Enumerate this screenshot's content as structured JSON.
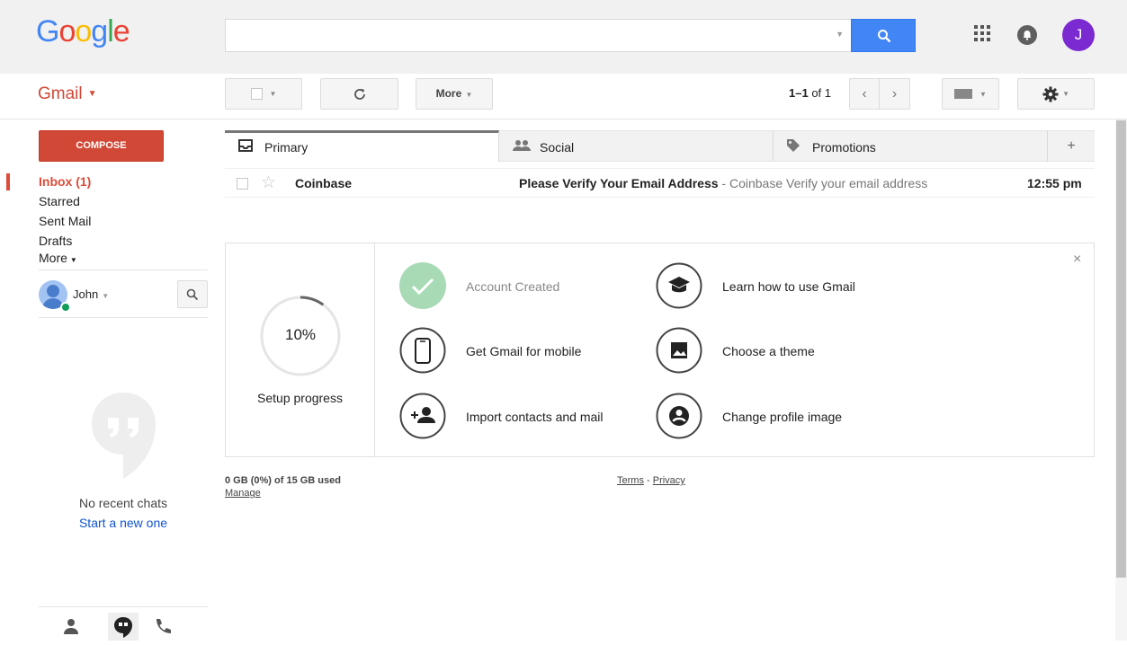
{
  "header": {
    "logo_letters": [
      "G",
      "o",
      "o",
      "g",
      "l",
      "e"
    ],
    "logo_colors": [
      "#4285f4",
      "#ea4335",
      "#fbbc05",
      "#4285f4",
      "#34a853",
      "#ea4335"
    ],
    "search_value": "",
    "avatar_letter": "J",
    "avatar_color": "#7b29d1"
  },
  "toolbar": {
    "app_label": "Gmail",
    "more_label": "More",
    "pager_range": "1–1",
    "pager_of": "of 1"
  },
  "sidebar": {
    "compose_label": "COMPOSE",
    "items": [
      {
        "label": "Inbox (1)",
        "active": true
      },
      {
        "label": "Starred"
      },
      {
        "label": "Sent Mail"
      },
      {
        "label": "Drafts"
      },
      {
        "label": "More"
      }
    ],
    "hangouts_user": "John",
    "no_chats_text": "No recent chats",
    "start_new_text": "Start a new one"
  },
  "tabs": [
    {
      "label": "Primary",
      "icon": "inbox-icon",
      "selected": true
    },
    {
      "label": "Social",
      "icon": "people-icon"
    },
    {
      "label": "Promotions",
      "icon": "tag-icon"
    },
    {
      "label": "+",
      "icon": "add-tab-icon"
    }
  ],
  "emails": [
    {
      "sender": "Coinbase",
      "subject": "Please Verify Your Email Address",
      "snippet": " - Coinbase Verify your email address",
      "time": "12:55 pm",
      "starred": false
    }
  ],
  "setup": {
    "percent": "10%",
    "progress_fraction": 0.1,
    "progress_label": "Setup progress",
    "close_symbol": "×",
    "steps": [
      {
        "label": "Account Created",
        "icon": "check-icon",
        "done": true
      },
      {
        "label": "Get Gmail for mobile",
        "icon": "phone-icon"
      },
      {
        "label": "Import contacts and mail",
        "icon": "add-person-icon"
      },
      {
        "label": "Learn how to use Gmail",
        "icon": "graduation-cap-icon"
      },
      {
        "label": "Choose a theme",
        "icon": "image-icon"
      },
      {
        "label": "Change profile image",
        "icon": "account-circle-icon"
      }
    ]
  },
  "footer": {
    "storage": "0 GB (0%) of 15 GB used",
    "manage": "Manage",
    "terms": "Terms",
    "separator": " - ",
    "privacy": "Privacy"
  }
}
